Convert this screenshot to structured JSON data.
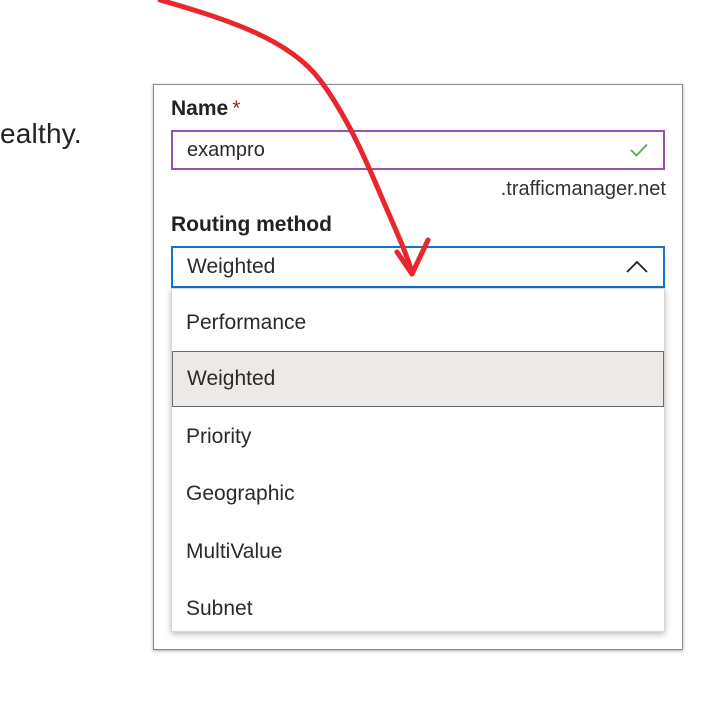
{
  "background": {
    "partial_text": "ealthy."
  },
  "form": {
    "name_label": "Name",
    "required_marker": "*",
    "name_value": "exampro",
    "name_suffix": ".trafficmanager.net",
    "routing_label": "Routing method",
    "routing_value": "Weighted",
    "routing_options": [
      {
        "label": "Performance",
        "selected": false
      },
      {
        "label": "Weighted",
        "selected": true
      },
      {
        "label": "Priority",
        "selected": false
      },
      {
        "label": "Geographic",
        "selected": false
      },
      {
        "label": "MultiValue",
        "selected": false
      },
      {
        "label": "Subnet",
        "selected": false
      }
    ]
  },
  "colors": {
    "input_border_valid": "#9b4fb0",
    "select_border_focus": "#1473c8",
    "check": "#57a64a",
    "required": "#a4262c",
    "annotation_arrow": "#e8262b",
    "selected_option_bg": "#ede9e6"
  },
  "icons": [
    "check-icon",
    "chevron-up-icon",
    "annotation-arrow"
  ]
}
